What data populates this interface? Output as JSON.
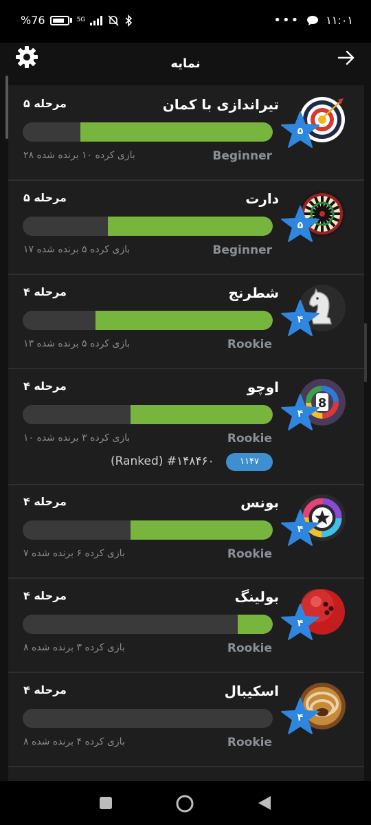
{
  "status_bar": {
    "battery": "%76",
    "network": "5G",
    "time": "۱۱:۰۱"
  },
  "header": {
    "title": "نمایه",
    "settings_icon": "gear-icon",
    "back_icon": "arrow-right-icon"
  },
  "games": [
    {
      "name": "تیراندازی با کمان",
      "level": "مرحله ۵",
      "tier": "Beginner",
      "stats": "۲۸ بازی کرده  ۱۰ برنده شده",
      "star": "۵",
      "progress": 0.77,
      "icon": "archery-target-icon"
    },
    {
      "name": "دارت",
      "level": "مرحله ۵",
      "tier": "Beginner",
      "stats": "۱۷ بازی کرده  ۵ برنده شده",
      "star": "۵",
      "progress": 0.66,
      "icon": "dartboard-icon"
    },
    {
      "name": "شطرنج",
      "level": "مرحله ۴",
      "tier": "Rookie",
      "stats": "۱۳ بازی کرده  ۵ برنده شده",
      "star": "۴",
      "progress": 0.71,
      "icon": "chess-knight-icon"
    },
    {
      "name": "اوچو",
      "level": "مرحله ۴",
      "tier": "Rookie",
      "stats": "۱۰ بازی کرده  ۳ برنده شده",
      "star": "۴",
      "progress": 0.57,
      "icon": "ocho-card-icon",
      "rating": "۱۱۴۷",
      "rank": "(Ranked) #۱۴۸۴۶۰"
    },
    {
      "name": "بونس",
      "level": "مرحله ۴",
      "tier": "Rookie",
      "stats": "۷ بازی کرده  ۶ برنده شده",
      "star": "۴",
      "progress": 0.57,
      "icon": "bounce-ball-icon"
    },
    {
      "name": "بولینگ",
      "level": "مرحله ۴",
      "tier": "Rookie",
      "stats": "۸ بازی کرده  ۳ برنده شده",
      "star": "۴",
      "progress": 0.14,
      "icon": "bowling-ball-icon"
    },
    {
      "name": "اسکیبال",
      "level": "مرحله ۴",
      "tier": "Rookie",
      "stats": "۸ بازی کرده  ۴ برنده شده",
      "star": "۴",
      "progress": 0.0,
      "icon": "skeeball-icon"
    }
  ],
  "colors": {
    "progress_fill": "#78b53e",
    "progress_track": "#3a3a3a",
    "star": "#2f86de",
    "card": "#1e1e1e",
    "background": "#121212"
  }
}
